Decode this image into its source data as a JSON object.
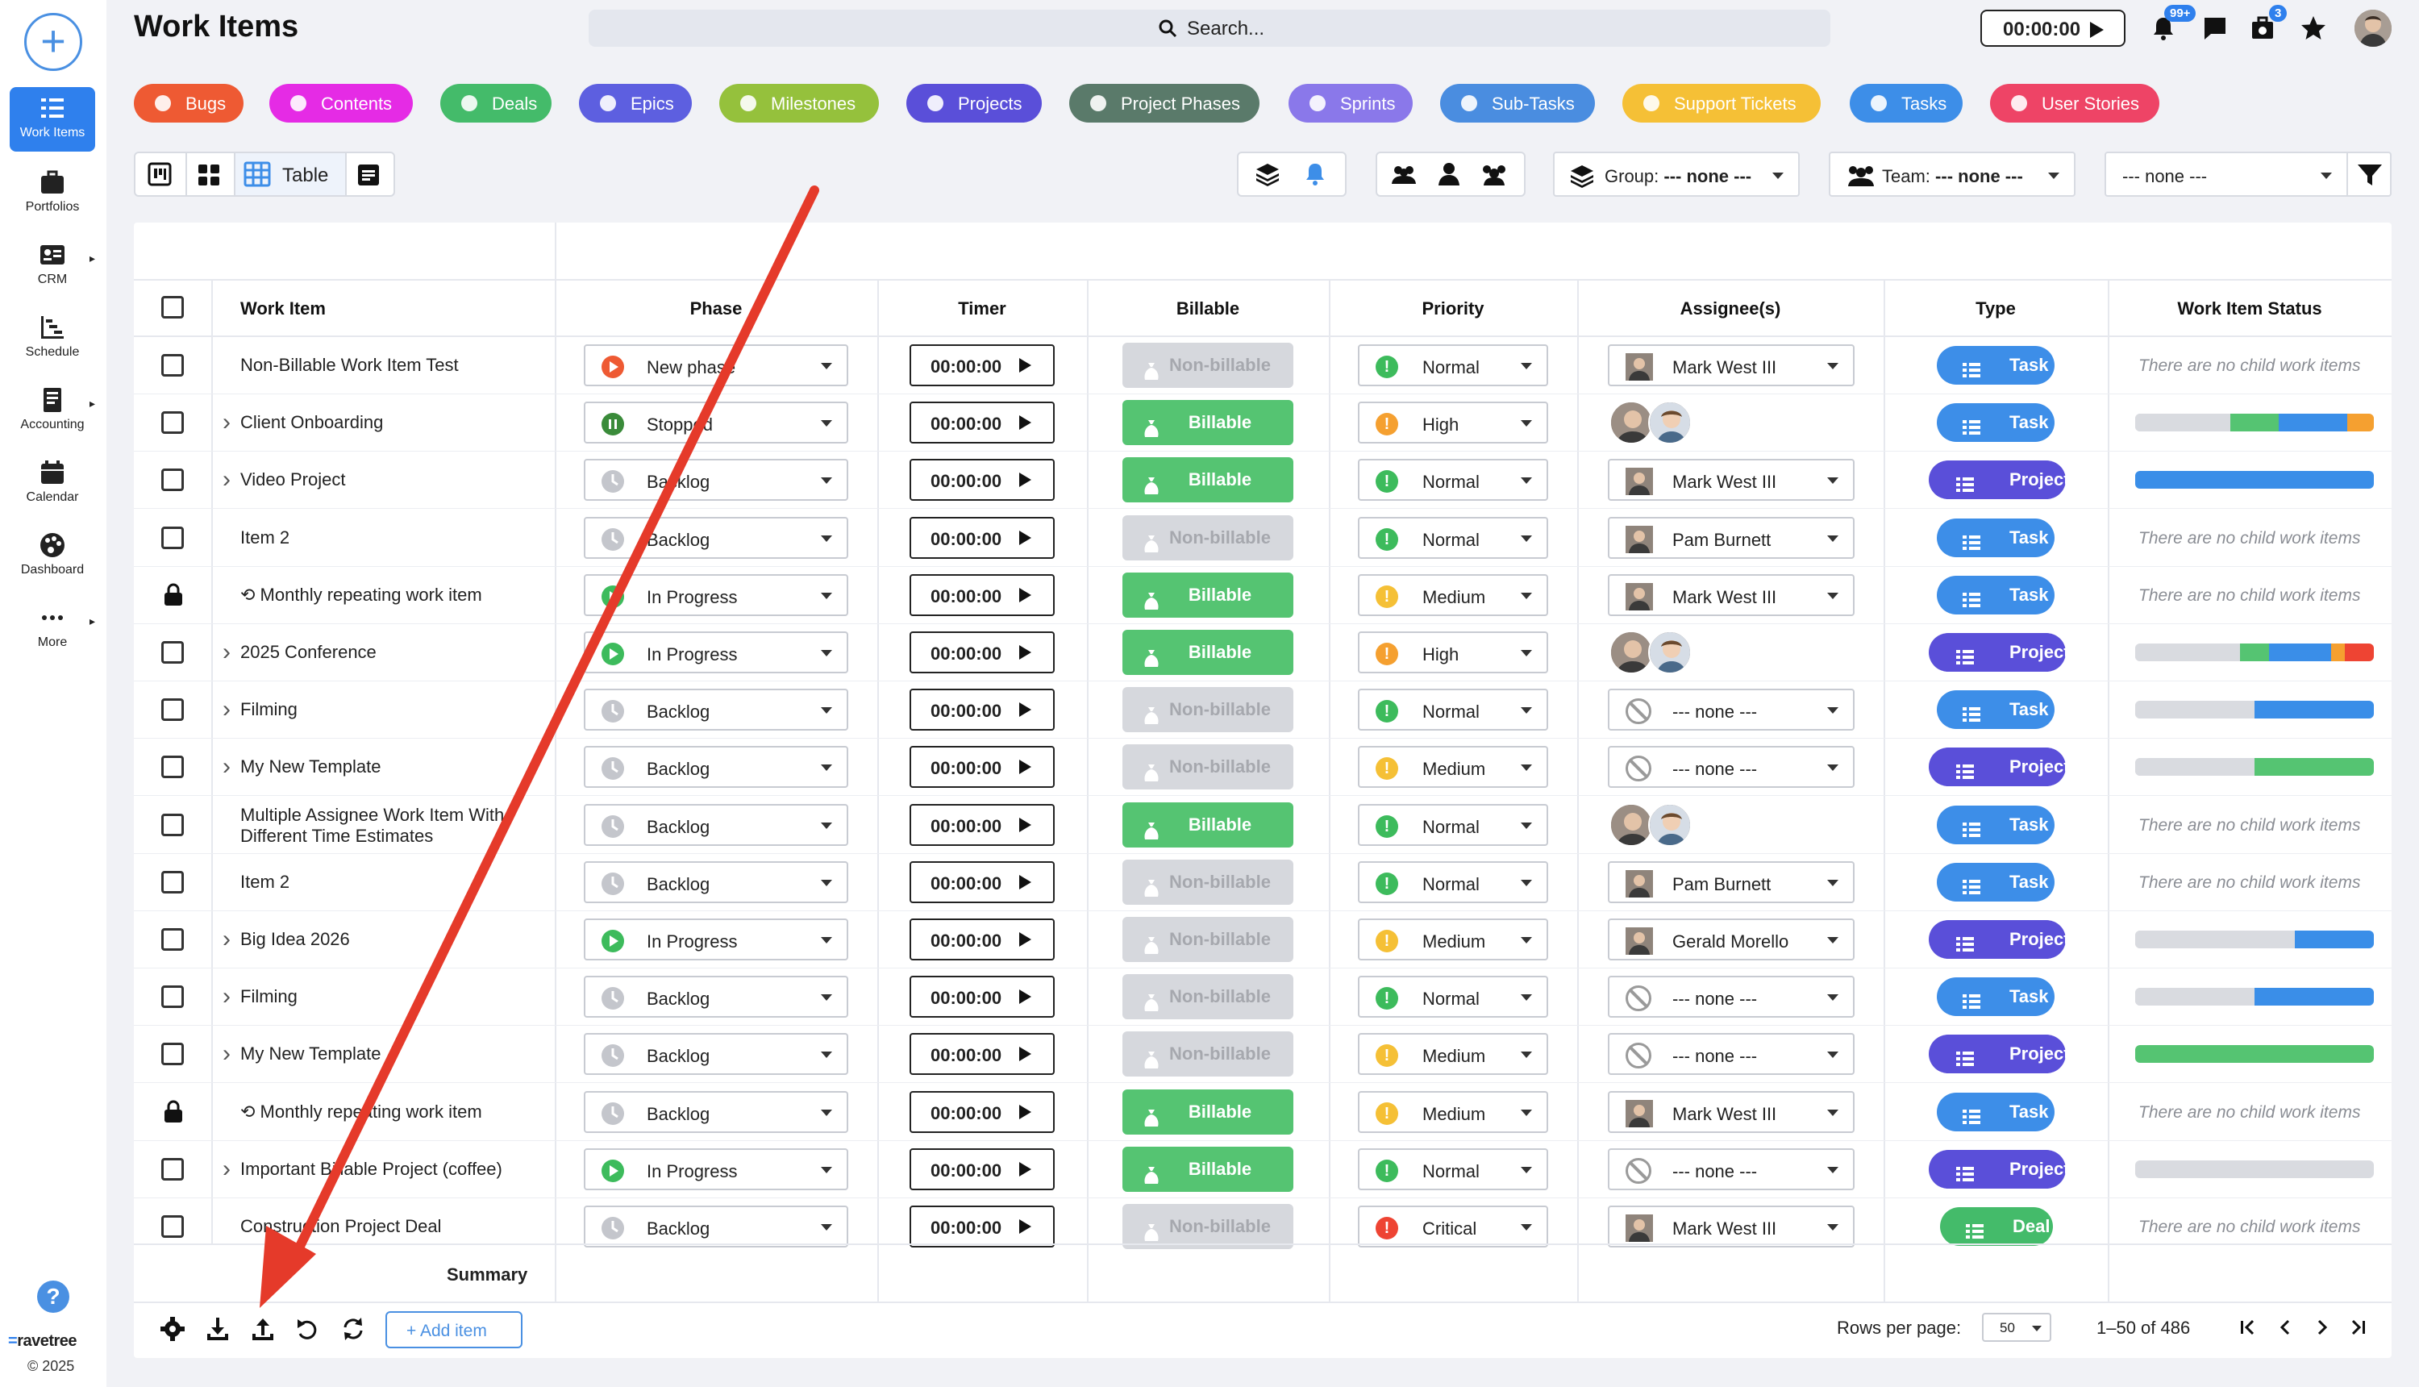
{
  "header": {
    "title": "Work Items",
    "search_placeholder": "Search...",
    "timer": "00:00:00",
    "notif_badge": "99+",
    "cart_badge": "3"
  },
  "rail": {
    "items": [
      {
        "label": "Work Items",
        "icon": "work-items-icon",
        "active": true
      },
      {
        "label": "Portfolios",
        "icon": "briefcase-icon"
      },
      {
        "label": "CRM",
        "icon": "contact-card-icon"
      },
      {
        "label": "Schedule",
        "icon": "schedule-chart-icon"
      },
      {
        "label": "Accounting",
        "icon": "ledger-icon"
      },
      {
        "label": "Calendar",
        "icon": "calendar-icon"
      },
      {
        "label": "Dashboard",
        "icon": "palette-icon"
      },
      {
        "label": "More",
        "icon": "more-dots-icon"
      }
    ],
    "brand_prefix": "=",
    "brand_name": "ravetree",
    "copyright": "© 2025"
  },
  "type_filters": [
    {
      "label": "Bugs",
      "color": "#ee5a33"
    },
    {
      "label": "Contents",
      "color": "#e52be5"
    },
    {
      "label": "Deals",
      "color": "#44bb6a"
    },
    {
      "label": "Epics",
      "color": "#5d5fe0"
    },
    {
      "label": "Milestones",
      "color": "#95c13c"
    },
    {
      "label": "Projects",
      "color": "#5a4fd9"
    },
    {
      "label": "Project Phases",
      "color": "#5a7a6a"
    },
    {
      "label": "Sprints",
      "color": "#8a78ea"
    },
    {
      "label": "Sub-Tasks",
      "color": "#4a8de0"
    },
    {
      "label": "Support Tickets",
      "color": "#f5c036"
    },
    {
      "label": "Tasks",
      "color": "#3d8ee8"
    },
    {
      "label": "User Stories",
      "color": "#ee4466"
    }
  ],
  "toolbar": {
    "table_label": "Table",
    "group_label": "Group:",
    "group_value": "--- none ---",
    "team_label": "Team:",
    "team_value": "--- none ---",
    "filter_value": "--- none ---"
  },
  "columns": [
    "Work Item",
    "Phase",
    "Timer",
    "Billable",
    "Priority",
    "Assignee(s)",
    "Type",
    "Work Item Status"
  ],
  "rows": [
    {
      "name": "Non-Billable Work Item Test",
      "expand": false,
      "lock": false,
      "repeat": false,
      "phase": "New phase",
      "phaseColor": "#ee5a33",
      "billable": "Non-billable",
      "priority": "Normal",
      "prioColor": "#3dbb5c",
      "assignee": "Mark West III",
      "assigneeType": "single",
      "type": "Task",
      "status": "There are no child work items",
      "bar": null
    },
    {
      "name": "Client Onboarding",
      "expand": true,
      "lock": false,
      "repeat": false,
      "phase": "Stopped",
      "phaseColor": "#3a8b3a",
      "billable": "Billable",
      "priority": "High",
      "prioColor": "#f5a030",
      "assignee": "",
      "assigneeType": "multi",
      "type": "Task",
      "status": "",
      "bar": [
        [
          40,
          "#d9dbe0"
        ],
        [
          20,
          "#55c472"
        ],
        [
          29,
          "#3a8ee8"
        ],
        [
          11,
          "#f5a030"
        ]
      ]
    },
    {
      "name": "Video Project",
      "expand": true,
      "lock": false,
      "repeat": false,
      "phase": "Backlog",
      "phaseColor": "#c4c6cc",
      "billable": "Billable",
      "priority": "Normal",
      "prioColor": "#3dbb5c",
      "assignee": "Mark West III",
      "assigneeType": "single",
      "type": "Project",
      "status": "",
      "bar": [
        [
          100,
          "#3a8ee8"
        ]
      ]
    },
    {
      "name": "Item 2",
      "expand": false,
      "lock": false,
      "repeat": false,
      "phase": "Backlog",
      "phaseColor": "#c4c6cc",
      "billable": "Non-billable",
      "priority": "Normal",
      "prioColor": "#3dbb5c",
      "assignee": "Pam Burnett",
      "assigneeType": "single",
      "type": "Task",
      "status": "There are no child work items",
      "bar": null
    },
    {
      "name": "Monthly repeating work item",
      "expand": false,
      "lock": true,
      "repeat": true,
      "phase": "In Progress",
      "phaseColor": "#3dbb5c",
      "billable": "Billable",
      "priority": "Medium",
      "prioColor": "#f5c036",
      "assignee": "Mark West III",
      "assigneeType": "single",
      "type": "Task",
      "status": "There are no child work items",
      "bar": null
    },
    {
      "name": "2025 Conference",
      "expand": true,
      "lock": false,
      "repeat": false,
      "phase": "In Progress",
      "phaseColor": "#3dbb5c",
      "billable": "Billable",
      "priority": "High",
      "prioColor": "#f5a030",
      "assignee": "",
      "assigneeType": "multi",
      "type": "Project",
      "status": "",
      "bar": [
        [
          44,
          "#d9dbe0"
        ],
        [
          12,
          "#55c472"
        ],
        [
          26,
          "#3a8ee8"
        ],
        [
          6,
          "#f5a030"
        ],
        [
          12,
          "#ee4433"
        ]
      ]
    },
    {
      "name": "Filming",
      "expand": true,
      "lock": false,
      "repeat": false,
      "phase": "Backlog",
      "phaseColor": "#c4c6cc",
      "billable": "Non-billable",
      "priority": "Normal",
      "prioColor": "#3dbb5c",
      "assignee": "--- none ---",
      "assigneeType": "none",
      "type": "Task",
      "status": "",
      "bar": [
        [
          50,
          "#d9dbe0"
        ],
        [
          50,
          "#3a8ee8"
        ]
      ]
    },
    {
      "name": "My New Template",
      "expand": true,
      "lock": false,
      "repeat": false,
      "phase": "Backlog",
      "phaseColor": "#c4c6cc",
      "billable": "Non-billable",
      "priority": "Medium",
      "prioColor": "#f5c036",
      "assignee": "--- none ---",
      "assigneeType": "none",
      "type": "Project",
      "status": "",
      "bar": [
        [
          50,
          "#d9dbe0"
        ],
        [
          50,
          "#55c472"
        ]
      ]
    },
    {
      "name": "Multiple Assignee Work Item With",
      "name2": "Different Time Estimates",
      "expand": false,
      "lock": false,
      "repeat": false,
      "phase": "Backlog",
      "phaseColor": "#c4c6cc",
      "billable": "Billable",
      "priority": "Normal",
      "prioColor": "#3dbb5c",
      "assignee": "",
      "assigneeType": "multi",
      "type": "Task",
      "status": "There are no child work items",
      "bar": null
    },
    {
      "name": "Item 2",
      "expand": false,
      "lock": false,
      "repeat": false,
      "phase": "Backlog",
      "phaseColor": "#c4c6cc",
      "billable": "Non-billable",
      "priority": "Normal",
      "prioColor": "#3dbb5c",
      "assignee": "Pam Burnett",
      "assigneeType": "single",
      "type": "Task",
      "status": "There are no child work items",
      "bar": null
    },
    {
      "name": "Big Idea 2026",
      "expand": true,
      "lock": false,
      "repeat": false,
      "phase": "In Progress",
      "phaseColor": "#3dbb5c",
      "billable": "Non-billable",
      "priority": "Medium",
      "prioColor": "#f5c036",
      "assignee": "Gerald Morello",
      "assigneeType": "single",
      "type": "Project",
      "status": "",
      "bar": [
        [
          67,
          "#d9dbe0"
        ],
        [
          33,
          "#3a8ee8"
        ]
      ]
    },
    {
      "name": "Filming",
      "expand": true,
      "lock": false,
      "repeat": false,
      "phase": "Backlog",
      "phaseColor": "#c4c6cc",
      "billable": "Non-billable",
      "priority": "Normal",
      "prioColor": "#3dbb5c",
      "assignee": "--- none ---",
      "assigneeType": "none",
      "type": "Task",
      "status": "",
      "bar": [
        [
          50,
          "#d9dbe0"
        ],
        [
          50,
          "#3a8ee8"
        ]
      ]
    },
    {
      "name": "My New Template",
      "expand": true,
      "lock": false,
      "repeat": false,
      "phase": "Backlog",
      "phaseColor": "#c4c6cc",
      "billable": "Non-billable",
      "priority": "Medium",
      "prioColor": "#f5c036",
      "assignee": "--- none ---",
      "assigneeType": "none",
      "type": "Project",
      "status": "",
      "bar": [
        [
          100,
          "#55c472"
        ]
      ]
    },
    {
      "name": "Monthly repeating work item",
      "expand": false,
      "lock": true,
      "repeat": true,
      "phase": "Backlog",
      "phaseColor": "#c4c6cc",
      "billable": "Billable",
      "priority": "Medium",
      "prioColor": "#f5c036",
      "assignee": "Mark West III",
      "assigneeType": "single",
      "type": "Task",
      "status": "There are no child work items",
      "bar": null
    },
    {
      "name": "Important Billable Project (coffee)",
      "expand": true,
      "lock": false,
      "repeat": false,
      "phase": "In Progress",
      "phaseColor": "#3dbb5c",
      "billable": "Billable",
      "priority": "Normal",
      "prioColor": "#3dbb5c",
      "assignee": "--- none ---",
      "assigneeType": "none",
      "type": "Project",
      "status": "",
      "bar": [
        [
          100,
          "#d9dbe0"
        ]
      ]
    },
    {
      "name": "Construction Project Deal",
      "expand": false,
      "lock": false,
      "repeat": false,
      "phase": "Backlog",
      "phaseColor": "#c4c6cc",
      "billable": "Non-billable",
      "priority": "Critical",
      "prioColor": "#ee4433",
      "assignee": "Mark West III",
      "assigneeType": "single",
      "type": "Deal",
      "status": "There are no child work items",
      "bar": null
    }
  ],
  "type_colors": {
    "Task": "#3d8ee8",
    "Project": "#5a4fd9",
    "Deal": "#44bb6a"
  },
  "billable_colors": {
    "Billable": "#55c472",
    "Non-billable": "#d6d8dd"
  },
  "footer": {
    "summary": "Summary",
    "add_item": "+ Add item",
    "rows_per_page_label": "Rows per page:",
    "rows_per_page": "50",
    "range": "1–50 of 486"
  },
  "annotation_color": "#e53a2a"
}
